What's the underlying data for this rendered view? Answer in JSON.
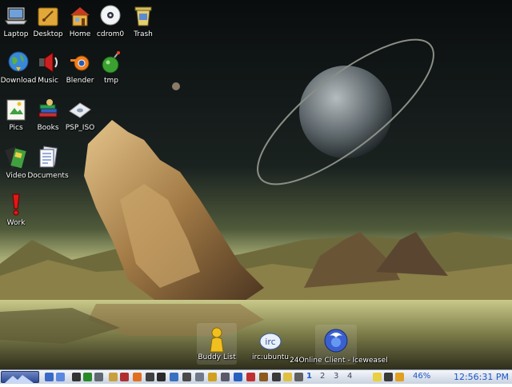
{
  "desktop_icons": [
    {
      "label": "Laptop",
      "icon": "laptop-icon"
    },
    {
      "label": "Desktop",
      "icon": "desktop-folder-icon"
    },
    {
      "label": "Home",
      "icon": "home-icon"
    },
    {
      "label": "cdrom0",
      "icon": "cdrom-icon"
    },
    {
      "label": "Trash",
      "icon": "trash-icon"
    },
    {
      "label": "Download",
      "icon": "globe-icon"
    },
    {
      "label": "Music",
      "icon": "speaker-icon"
    },
    {
      "label": "Blender",
      "icon": "blender-icon"
    },
    {
      "label": "tmp",
      "icon": "bomb-icon"
    },
    {
      "label": "Pics",
      "icon": "picture-icon"
    },
    {
      "label": "Books",
      "icon": "books-icon"
    },
    {
      "label": "PSP_ISO",
      "icon": "disc-icon"
    },
    {
      "label": "Video",
      "icon": "film-icon"
    },
    {
      "label": "Documents",
      "icon": "document-icon"
    },
    {
      "label": "Work",
      "icon": "exclamation-icon"
    }
  ],
  "dock": [
    {
      "label": "Buddy List",
      "icon": "buddy-icon"
    },
    {
      "label": "irc:ubuntu",
      "icon": "irc-icon"
    },
    {
      "label": "24Online Client - Iceweasel",
      "icon": "iceweasel-icon"
    }
  ],
  "taskbar": {
    "virtual_desktops": [
      "1",
      "2",
      "3",
      "4"
    ],
    "active_desktop": "1",
    "battery": "46%",
    "clock": "12:56:31 PM"
  },
  "colors": {
    "taskbar_text": "#1a56c8",
    "accent": "#2d4b94"
  }
}
